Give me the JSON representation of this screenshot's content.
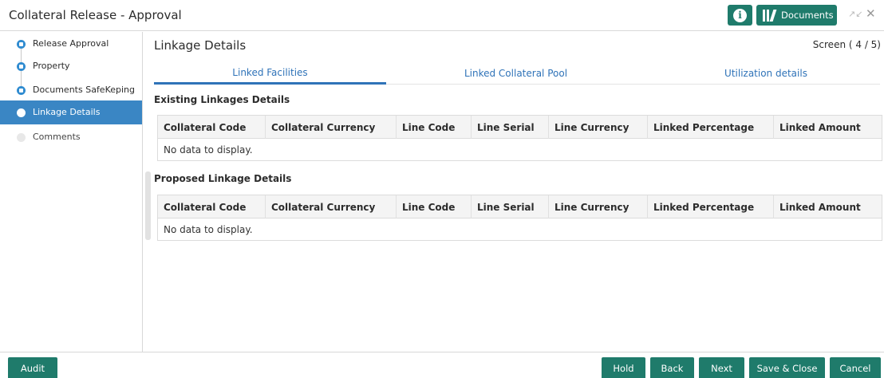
{
  "header": {
    "title": "Collateral Release - Approval",
    "info_icon": "info-icon",
    "documents_label": "Documents",
    "documents_icon": "library-icon",
    "minimize_icon": "resize-icon",
    "close_icon": "close-icon",
    "accent_color": "#1f7b6b"
  },
  "sidebar": {
    "items": [
      {
        "label": "Release Approval",
        "state": "done"
      },
      {
        "label": "Property",
        "state": "done"
      },
      {
        "label": "Documents SafeKeping",
        "state": "done"
      },
      {
        "label": "Linkage Details",
        "state": "active"
      },
      {
        "label": "Comments",
        "state": "pending"
      }
    ],
    "active_color": "#3a86c4"
  },
  "main": {
    "title": "Linkage Details",
    "screen_indicator": "Screen ( 4 / 5)",
    "tabs": [
      {
        "label": "Linked Facilities",
        "selected": true
      },
      {
        "label": "Linked Collateral Pool",
        "selected": false
      },
      {
        "label": "Utilization details",
        "selected": false
      }
    ],
    "existing": {
      "title": "Existing Linkages Details",
      "columns": [
        "Collateral Code",
        "Collateral Currency",
        "Line Code",
        "Line Serial",
        "Line Currency",
        "Linked Percentage",
        "Linked Amount"
      ],
      "empty_text": "No data to display."
    },
    "proposed": {
      "title": "Proposed Linkage Details",
      "columns": [
        "Collateral Code",
        "Collateral Currency",
        "Line Code",
        "Line Serial",
        "Line Currency",
        "Linked Percentage",
        "Linked Amount"
      ],
      "empty_text": "No data to display."
    }
  },
  "footer": {
    "audit": "Audit",
    "hold": "Hold",
    "back": "Back",
    "next": "Next",
    "save_close": "Save & Close",
    "cancel": "Cancel"
  }
}
